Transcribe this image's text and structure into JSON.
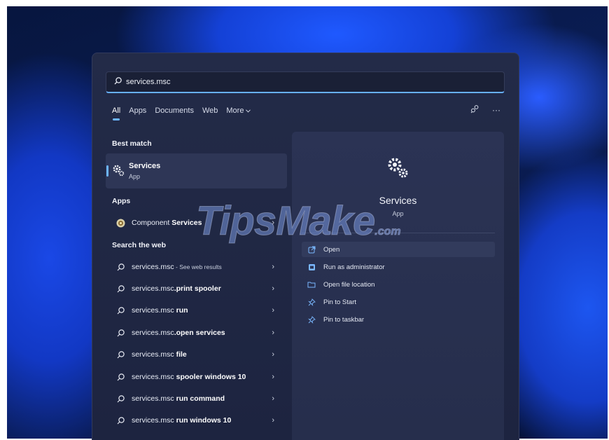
{
  "search": {
    "value": "services.msc",
    "icon": "search-icon"
  },
  "tabs": [
    {
      "label": "All"
    },
    {
      "label": "Apps"
    },
    {
      "label": "Documents"
    },
    {
      "label": "Web"
    },
    {
      "label": "More"
    }
  ],
  "top_actions": {
    "share_icon": "share-icon",
    "more_label": "···"
  },
  "best_match": {
    "heading": "Best match",
    "title": "Services",
    "subtitle": "App",
    "icon": "gears-icon"
  },
  "apps": {
    "heading": "Apps",
    "items": [
      {
        "prefix": "Component ",
        "bold": "Services",
        "icon": "component-services-icon"
      }
    ]
  },
  "web": {
    "heading": "Search the web",
    "items": [
      {
        "prefix": "services.msc",
        "bold": "",
        "small": " - See web results"
      },
      {
        "prefix": "services.msc",
        "bold": ".print spooler",
        "small": ""
      },
      {
        "prefix": "services.msc",
        "bold": " run",
        "small": ""
      },
      {
        "prefix": "services.msc",
        "bold": ".open services",
        "small": ""
      },
      {
        "prefix": "services.msc",
        "bold": " file",
        "small": ""
      },
      {
        "prefix": "services.msc",
        "bold": " spooler windows 10",
        "small": ""
      },
      {
        "prefix": "services.msc",
        "bold": " run command",
        "small": ""
      },
      {
        "prefix": "services.msc",
        "bold": " run windows 10",
        "small": ""
      }
    ]
  },
  "chevron": "›",
  "detail": {
    "title": "Services",
    "subtitle": "App",
    "actions": [
      {
        "label": "Open",
        "icon": "open-icon"
      },
      {
        "label": "Run as administrator",
        "icon": "admin-shield-icon"
      },
      {
        "label": "Open file location",
        "icon": "folder-icon"
      },
      {
        "label": "Pin to Start",
        "icon": "pin-icon"
      },
      {
        "label": "Pin to taskbar",
        "icon": "pin-icon"
      }
    ]
  },
  "watermark": {
    "main": "TipsMake",
    "suffix": ".com"
  },
  "colors": {
    "accent": "#6cb4ff",
    "panel": "#1d2440",
    "detail_panel": "#2b3354"
  }
}
